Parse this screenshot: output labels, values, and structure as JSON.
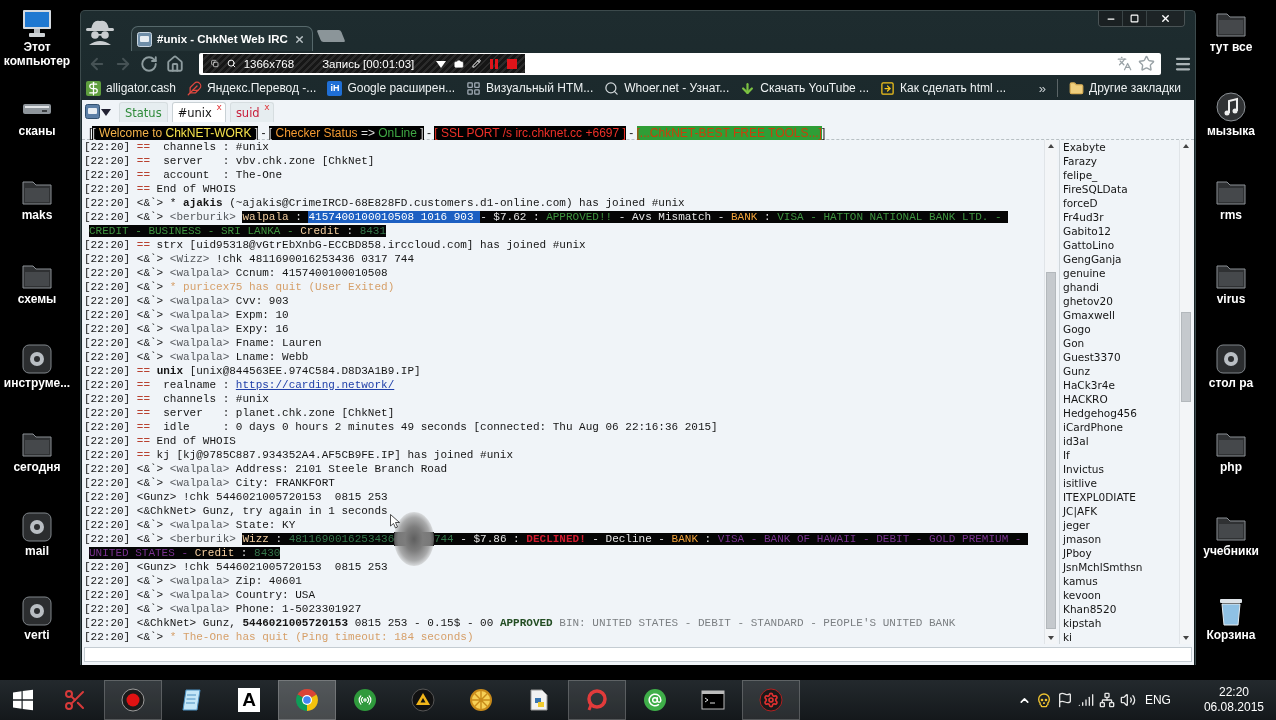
{
  "desktop": {
    "left_icons": [
      {
        "label": "Этот компьютер",
        "kind": "computer"
      },
      {
        "label": "сканы",
        "kind": "device"
      },
      {
        "label": "maks",
        "kind": "folder"
      },
      {
        "label": "схемы",
        "kind": "folder"
      },
      {
        "label": "инструме...",
        "kind": "app"
      },
      {
        "label": "сегодня",
        "kind": "folder"
      },
      {
        "label": "mail",
        "kind": "app"
      },
      {
        "label": "verti",
        "kind": "app"
      }
    ],
    "right_icons": [
      {
        "label": "тут все",
        "kind": "folder"
      },
      {
        "label": "мызыка",
        "kind": "music"
      },
      {
        "label": "rms",
        "kind": "folder"
      },
      {
        "label": "virus",
        "kind": "folder"
      },
      {
        "label": "стол ра",
        "kind": "app"
      },
      {
        "label": "php",
        "kind": "folder"
      },
      {
        "label": "учебники",
        "kind": "folder"
      },
      {
        "label": "Корзина",
        "kind": "trash"
      }
    ]
  },
  "browser": {
    "tab": {
      "title": "#unix - ChkNet Web IRC"
    },
    "nav": [
      {
        "kind": "back",
        "disabled": true
      },
      {
        "kind": "forward",
        "disabled": true
      },
      {
        "kind": "reload",
        "disabled": false
      },
      {
        "kind": "home",
        "disabled": false
      }
    ],
    "recorder": {
      "resolution": "1366x768",
      "status": "Запись [00:01:03]"
    },
    "bookmarks": [
      {
        "label": "alligator.cash",
        "kind": "dollar"
      },
      {
        "label": "Яндекс.Перевод -...",
        "kind": "feather"
      },
      {
        "label": "Google расширен...",
        "kind": "badge",
        "badge": "iH"
      },
      {
        "label": "Визуальный HTM...",
        "kind": "grid"
      },
      {
        "label": "Whoer.net - Узнат...",
        "kind": "search"
      },
      {
        "label": "Скачать YouTube ...",
        "kind": "download"
      },
      {
        "label": "Как сделать html ...",
        "kind": "arrow"
      }
    ],
    "bookmarks_overflow": "»",
    "other_bookmarks": "Другие закладки"
  },
  "irc": {
    "tabs": [
      {
        "label": "Status",
        "selected": false,
        "color": "#2e8b3a"
      },
      {
        "label": "#unix",
        "selected": true,
        "color": "#111111",
        "close": "x"
      },
      {
        "label": "suid",
        "selected": false,
        "color": "#c8203c",
        "close": "x"
      }
    ],
    "topic": [
      {
        "kind": "plain",
        "text": "["
      },
      {
        "kind": "white",
        "text": "[ "
      },
      {
        "kind": "gold",
        "text": "Welcome to "
      },
      {
        "kind": "yellow",
        "text": "ChkNET-WORK"
      },
      {
        "kind": "white",
        "text": " ]"
      },
      {
        "kind": "plain",
        "text": " - "
      },
      {
        "kind": "white",
        "text": "[ "
      },
      {
        "kind": "orange",
        "text": "Checker Status"
      },
      {
        "kind": "white",
        "text": " => "
      },
      {
        "kind": "green",
        "text": "OnLine"
      },
      {
        "kind": "white",
        "text": " ]"
      },
      {
        "kind": "plain",
        "text": " - "
      },
      {
        "kind": "red",
        "text": "[ SSL PORT /s irc.chknet.cc +6697 ]"
      },
      {
        "kind": "plain",
        "text": " - "
      },
      {
        "kind": "on-green",
        "text": "[...ChkNET-BEST FREE TOOLS...]"
      },
      {
        "kind": "plain",
        "text": "]"
      }
    ],
    "log": [
      [
        {
          "kind": "time",
          "text": "[22:20] "
        },
        {
          "kind": "op",
          "text": "=="
        },
        {
          "kind": "text",
          "text": "  channels : #unix"
        }
      ],
      [
        {
          "kind": "time",
          "text": "[22:20] "
        },
        {
          "kind": "op",
          "text": "=="
        },
        {
          "kind": "text",
          "text": "  server   : vbv.chk.zone [ChkNet]"
        }
      ],
      [
        {
          "kind": "time",
          "text": "[22:20] "
        },
        {
          "kind": "op",
          "text": "=="
        },
        {
          "kind": "text",
          "text": "  account  : The-One"
        }
      ],
      [
        {
          "kind": "time",
          "text": "[22:20] "
        },
        {
          "kind": "op",
          "text": "=="
        },
        {
          "kind": "text",
          "text": " End of WHOIS"
        }
      ],
      [
        {
          "kind": "time",
          "text": "[22:20] "
        },
        {
          "kind": "text",
          "text": "<&`> * "
        },
        {
          "kind": "bold",
          "text": "ajakis"
        },
        {
          "kind": "text",
          "text": " (~ajakis@CrimeIRCD-68E828FD.customers.d1-online.com) has joined #unix"
        }
      ],
      [
        {
          "kind": "time",
          "text": "[22:20] "
        },
        {
          "kind": "text",
          "text": "<&`> "
        },
        {
          "kind": "nick",
          "text": "<berburik> "
        },
        {
          "kind": "hl-nick",
          "text": "walpala"
        },
        {
          "kind": "hl-text",
          "text": " : "
        },
        {
          "kind": "hl-sel",
          "text": "4157400100010508 1016 903 "
        },
        {
          "kind": "hl-text",
          "text": "- $7.62 : "
        },
        {
          "kind": "hl-green",
          "text": "APPROVED!!"
        },
        {
          "kind": "hl-text",
          "text": " - Avs Mismatch - "
        },
        {
          "kind": "hl-orange",
          "text": "BANK"
        },
        {
          "kind": "hl-text",
          "text": " : "
        },
        {
          "kind": "hl-green",
          "text": "VISA - HATTON NATIONAL BANK LTD. - "
        }
      ],
      [
        {
          "kind": "hl-green",
          "text": "CREDIT - BUSINESS - SRI LANKA - "
        },
        {
          "kind": "hl-nick",
          "text": "Credit"
        },
        {
          "kind": "hl-text",
          "text": " : "
        },
        {
          "kind": "hl-dark",
          "text": "8431"
        }
      ],
      [
        {
          "kind": "time",
          "text": "[22:20] "
        },
        {
          "kind": "op",
          "text": "=="
        },
        {
          "kind": "text",
          "text": " strx [uid95318@vGtrEbXnbG-ECCBD858.irccloud.com] has joined #unix"
        }
      ],
      [
        {
          "kind": "time",
          "text": "[22:20] "
        },
        {
          "kind": "text",
          "text": "<&`> "
        },
        {
          "kind": "nick",
          "text": "<Wizz>"
        },
        {
          "kind": "text",
          "text": " !chk 4811690016253436 0317 744"
        }
      ],
      [
        {
          "kind": "time",
          "text": "[22:20] "
        },
        {
          "kind": "text",
          "text": "<&`> "
        },
        {
          "kind": "nick",
          "text": "<walpala>"
        },
        {
          "kind": "text",
          "text": " Ccnum: 4157400100010508"
        }
      ],
      [
        {
          "kind": "time",
          "text": "[22:20] "
        },
        {
          "kind": "text",
          "text": "<&`> "
        },
        {
          "kind": "action",
          "text": "* puricex75 has quit (User Exited)"
        }
      ],
      [
        {
          "kind": "time",
          "text": "[22:20] "
        },
        {
          "kind": "text",
          "text": "<&`> "
        },
        {
          "kind": "nick",
          "text": "<walpala>"
        },
        {
          "kind": "text",
          "text": " Cvv: 903"
        }
      ],
      [
        {
          "kind": "time",
          "text": "[22:20] "
        },
        {
          "kind": "text",
          "text": "<&`> "
        },
        {
          "kind": "nick",
          "text": "<walpala>"
        },
        {
          "kind": "text",
          "text": " Expm: 10"
        }
      ],
      [
        {
          "kind": "time",
          "text": "[22:20] "
        },
        {
          "kind": "text",
          "text": "<&`> "
        },
        {
          "kind": "nick",
          "text": "<walpala>"
        },
        {
          "kind": "text",
          "text": " Expy: 16"
        }
      ],
      [
        {
          "kind": "time",
          "text": "[22:20] "
        },
        {
          "kind": "text",
          "text": "<&`> "
        },
        {
          "kind": "nick",
          "text": "<walpala>"
        },
        {
          "kind": "text",
          "text": " Fname: Lauren"
        }
      ],
      [
        {
          "kind": "time",
          "text": "[22:20] "
        },
        {
          "kind": "text",
          "text": "<&`> "
        },
        {
          "kind": "nick",
          "text": "<walpala>"
        },
        {
          "kind": "text",
          "text": " Lname: Webb"
        }
      ],
      [
        {
          "kind": "time",
          "text": "[22:20] "
        },
        {
          "kind": "op",
          "text": "== "
        },
        {
          "kind": "bold",
          "text": "unix"
        },
        {
          "kind": "text",
          "text": " [unix@844563EE.974C584.D8D3A1B9.IP]"
        }
      ],
      [
        {
          "kind": "time",
          "text": "[22:20] "
        },
        {
          "kind": "op",
          "text": "=="
        },
        {
          "kind": "text",
          "text": "  realname : "
        },
        {
          "kind": "link",
          "text": "https://carding.network/"
        }
      ],
      [
        {
          "kind": "time",
          "text": "[22:20] "
        },
        {
          "kind": "op",
          "text": "=="
        },
        {
          "kind": "text",
          "text": "  channels : #unix"
        }
      ],
      [
        {
          "kind": "time",
          "text": "[22:20] "
        },
        {
          "kind": "op",
          "text": "=="
        },
        {
          "kind": "text",
          "text": "  server   : planet.chk.zone [ChkNet]"
        }
      ],
      [
        {
          "kind": "time",
          "text": "[22:20] "
        },
        {
          "kind": "op",
          "text": "=="
        },
        {
          "kind": "text",
          "text": "  idle     : 0 days 0 hours 2 minutes 49 seconds [connected: Thu Aug 06 22:16:36 2015]"
        }
      ],
      [
        {
          "kind": "time",
          "text": "[22:20] "
        },
        {
          "kind": "op",
          "text": "=="
        },
        {
          "kind": "text",
          "text": " End of WHOIS"
        }
      ],
      [
        {
          "kind": "time",
          "text": "[22:20] "
        },
        {
          "kind": "op",
          "text": "=="
        },
        {
          "kind": "text",
          "text": " kj [kj@9785C887.934352A4.AF5CB9FE.IP] has joined #unix"
        }
      ],
      [
        {
          "kind": "time",
          "text": "[22:20] "
        },
        {
          "kind": "text",
          "text": "<&`> "
        },
        {
          "kind": "nick",
          "text": "<walpala>"
        },
        {
          "kind": "text",
          "text": " Address: 2101 Steele Branch Road"
        }
      ],
      [
        {
          "kind": "time",
          "text": "[22:20] "
        },
        {
          "kind": "text",
          "text": "<&`> "
        },
        {
          "kind": "nick",
          "text": "<walpala>"
        },
        {
          "kind": "text",
          "text": " City: FRANKFORT"
        }
      ],
      [
        {
          "kind": "time",
          "text": "[22:20] "
        },
        {
          "kind": "text",
          "text": "<Gunz> !chk 5446021005720153  0815 253"
        }
      ],
      [
        {
          "kind": "time",
          "text": "[22:20] "
        },
        {
          "kind": "text",
          "text": "<&ChkNet> Gunz, try again in 1 seconds"
        }
      ],
      [
        {
          "kind": "time",
          "text": "[22:20] "
        },
        {
          "kind": "text",
          "text": "<&`> "
        },
        {
          "kind": "nick",
          "text": "<walpala>"
        },
        {
          "kind": "text",
          "text": " State: KY"
        }
      ],
      [
        {
          "kind": "time",
          "text": "[22:20] "
        },
        {
          "kind": "text",
          "text": "<&`> "
        },
        {
          "kind": "nick",
          "text": "<berburik> "
        },
        {
          "kind": "hl-nick",
          "text": "Wizz"
        },
        {
          "kind": "hl-text",
          "text": " : "
        },
        {
          "kind": "hl-dark",
          "text": "4811690016253436"
        },
        {
          "kind": "smudge"
        },
        {
          "kind": "hl-dark",
          "text": "744"
        },
        {
          "kind": "hl-text",
          "text": " - $7.86 : "
        },
        {
          "kind": "hl-red",
          "text": "DECLINED!"
        },
        {
          "kind": "hl-text",
          "text": " - Decline - "
        },
        {
          "kind": "hl-orange",
          "text": "BANK"
        },
        {
          "kind": "hl-text",
          "text": " : "
        },
        {
          "kind": "hl-purple",
          "text": "VISA - BANK OF HAWAII - DEBIT - GOLD PREMIUM - "
        }
      ],
      [
        {
          "kind": "hl-purple",
          "text": "UNITED STATES - "
        },
        {
          "kind": "hl-nick",
          "text": "Credit"
        },
        {
          "kind": "hl-text",
          "text": " : "
        },
        {
          "kind": "hl-dark",
          "text": "8430"
        }
      ],
      [
        {
          "kind": "time",
          "text": "[22:20] "
        },
        {
          "kind": "text",
          "text": "<Gunz> !chk 5446021005720153  0815 253"
        }
      ],
      [
        {
          "kind": "time",
          "text": "[22:20] "
        },
        {
          "kind": "text",
          "text": "<&`> "
        },
        {
          "kind": "nick",
          "text": "<walpala>"
        },
        {
          "kind": "text",
          "text": " Zip: 40601"
        }
      ],
      [
        {
          "kind": "time",
          "text": "[22:20] "
        },
        {
          "kind": "text",
          "text": "<&`> "
        },
        {
          "kind": "nick",
          "text": "<walpala>"
        },
        {
          "kind": "text",
          "text": " Country: USA"
        }
      ],
      [
        {
          "kind": "time",
          "text": "[22:20] "
        },
        {
          "kind": "text",
          "text": "<&`> "
        },
        {
          "kind": "nick",
          "text": "<walpala>"
        },
        {
          "kind": "text",
          "text": " Phone: 1-5023301927"
        }
      ],
      [
        {
          "kind": "time",
          "text": "[22:20] "
        },
        {
          "kind": "text",
          "text": "<&ChkNet> Gunz, "
        },
        {
          "kind": "bold",
          "text": "5446021005720153"
        },
        {
          "kind": "text",
          "text": " 0815 253 - 0.15$ - 00 "
        },
        {
          "kind": "ok",
          "text": "APPROVED "
        },
        {
          "kind": "muted",
          "text": "BIN: UNITED STATES - DEBIT - STANDARD - PEOPLE'S UNITED BANK"
        }
      ],
      [
        {
          "kind": "time",
          "text": "[22:20] "
        },
        {
          "kind": "text",
          "text": "<&`> "
        },
        {
          "kind": "action",
          "text": "* The-One has quit (Ping timeout: 184 seconds)"
        }
      ]
    ],
    "nicks": [
      "Exabyte",
      "Farazy",
      "felipe_",
      "FireSQLData",
      "forceD",
      "Fr4ud3r",
      "Gabito12",
      "GattoLino",
      "GengGanja",
      "genuine",
      "ghandi",
      "ghetov20",
      "Gmaxwell",
      "Gogo",
      "Gon",
      "Guest3370",
      "Gunz",
      "HaCk3r4e",
      "HACKRO",
      "Hedgehog456",
      "iCardPhone",
      "id3al",
      "If",
      "Invictus",
      "isitlive",
      "ITEXPL0DIATE",
      "JC|AFK",
      "jeger",
      "jmason",
      "JPboy",
      "JsnMchlSmthsn",
      "kamus",
      "kevoon",
      "Khan8520",
      "kipstah",
      "ki"
    ]
  },
  "taskbar": {
    "apps": [
      {
        "kind": "scissors",
        "running": false,
        "selected": false
      },
      {
        "kind": "record",
        "running": true,
        "selected": false
      },
      {
        "kind": "notepad",
        "running": false,
        "selected": false
      },
      {
        "kind": "letter",
        "glyph": "A",
        "running": false,
        "selected": false
      },
      {
        "kind": "browser",
        "running": true,
        "selected": true
      },
      {
        "kind": "antenna",
        "running": false,
        "selected": false
      },
      {
        "kind": "triangle",
        "running": false,
        "selected": false
      },
      {
        "kind": "wheel",
        "running": false,
        "selected": false
      },
      {
        "kind": "document",
        "running": false,
        "selected": false
      },
      {
        "kind": "ring",
        "running": true,
        "selected": false
      },
      {
        "kind": "at",
        "running": false,
        "selected": false
      },
      {
        "kind": "terminal",
        "running": false,
        "selected": false
      },
      {
        "kind": "gear",
        "running": true,
        "selected": false
      }
    ],
    "tray": {
      "language": "ENG",
      "time": "22:20",
      "date": "06.08.2015"
    }
  }
}
